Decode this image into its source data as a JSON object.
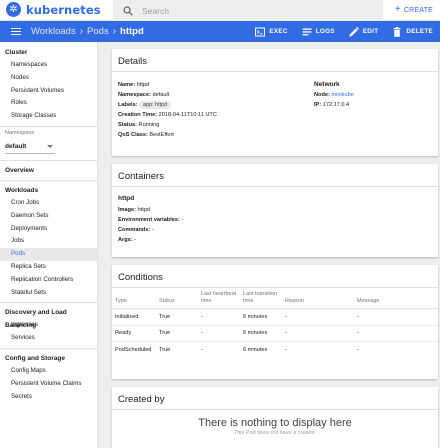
{
  "app": {
    "logo_text": "kubernetes",
    "logo_glyph": "✲"
  },
  "search": {
    "placeholder": "Search"
  },
  "create": {
    "plus": "+",
    "label": "CREATE"
  },
  "breadcrumb": {
    "workloads": "Workloads",
    "pods": "Pods",
    "current": "httpd",
    "separator": "›"
  },
  "actions": {
    "exec": "EXEC",
    "logs": "LOGS",
    "edit": "EDIT",
    "delete": "DELETE"
  },
  "sidebar": {
    "cluster": {
      "heading": "Cluster",
      "items": [
        "Namespaces",
        "Nodes",
        "Persistent Volumes",
        "Roles",
        "Storage Classes"
      ]
    },
    "namespace": {
      "label": "Namespace",
      "value": "default"
    },
    "overview": "Overview",
    "workloads": {
      "heading": "Workloads",
      "items": [
        "Cron Jobs",
        "Daemon Sets",
        "Deployments",
        "Jobs",
        "Pods",
        "Replica Sets",
        "Replication Controllers",
        "Stateful Sets"
      ]
    },
    "discovery": {
      "heading": "Discovery and Load Balancing",
      "items": [
        "Ingresses",
        "Services"
      ]
    },
    "config": {
      "heading": "Config and Storage",
      "items": [
        "Config Maps",
        "Persistent Volume Claims",
        "Secrets"
      ]
    }
  },
  "details": {
    "title": "Details",
    "name_label": "Name:",
    "name_value": "httpd",
    "namespace_label": "Namespace:",
    "namespace_value": "default",
    "labels_label": "Labels:",
    "labels_chip": "app: httpd",
    "creation_label": "Creation Time:",
    "creation_value": "2018-04-11T10:11 UTC",
    "status_label": "Status:",
    "status_value": "Running",
    "qos_label": "QoS Class:",
    "qos_value": "BestEffort",
    "network_title": "Network",
    "node_label": "Node:",
    "node_value": "minikube",
    "ip_label": "IP:",
    "ip_value": "172.17.0.4"
  },
  "containers": {
    "title": "Containers",
    "name": "httpd",
    "image_label": "Image:",
    "image_value": "httpd",
    "env_label": "Environment variables:",
    "env_value": "-",
    "commands_label": "Commands:",
    "commands_value": "-",
    "args_label": "Args:",
    "args_value": "-"
  },
  "conditions": {
    "title": "Conditions",
    "columns": [
      "Type",
      "Status",
      "Last heartbeat time",
      "Last transition time",
      "Reason",
      "Message"
    ],
    "rows": [
      [
        "Initialized",
        "True",
        "-",
        "6 minutes",
        "-",
        "-"
      ],
      [
        "Ready",
        "True",
        "-",
        "6 minutes",
        "-",
        "-"
      ],
      [
        "PodScheduled",
        "True",
        "-",
        "6 minutes",
        "-",
        "-"
      ]
    ]
  },
  "created_by": {
    "title": "Created by",
    "empty_title": "There is nothing to display here",
    "empty_subtitle": "This Pod does not have a creator."
  },
  "colors": {
    "brand": "#326ce5",
    "background": "#eeeeee"
  }
}
